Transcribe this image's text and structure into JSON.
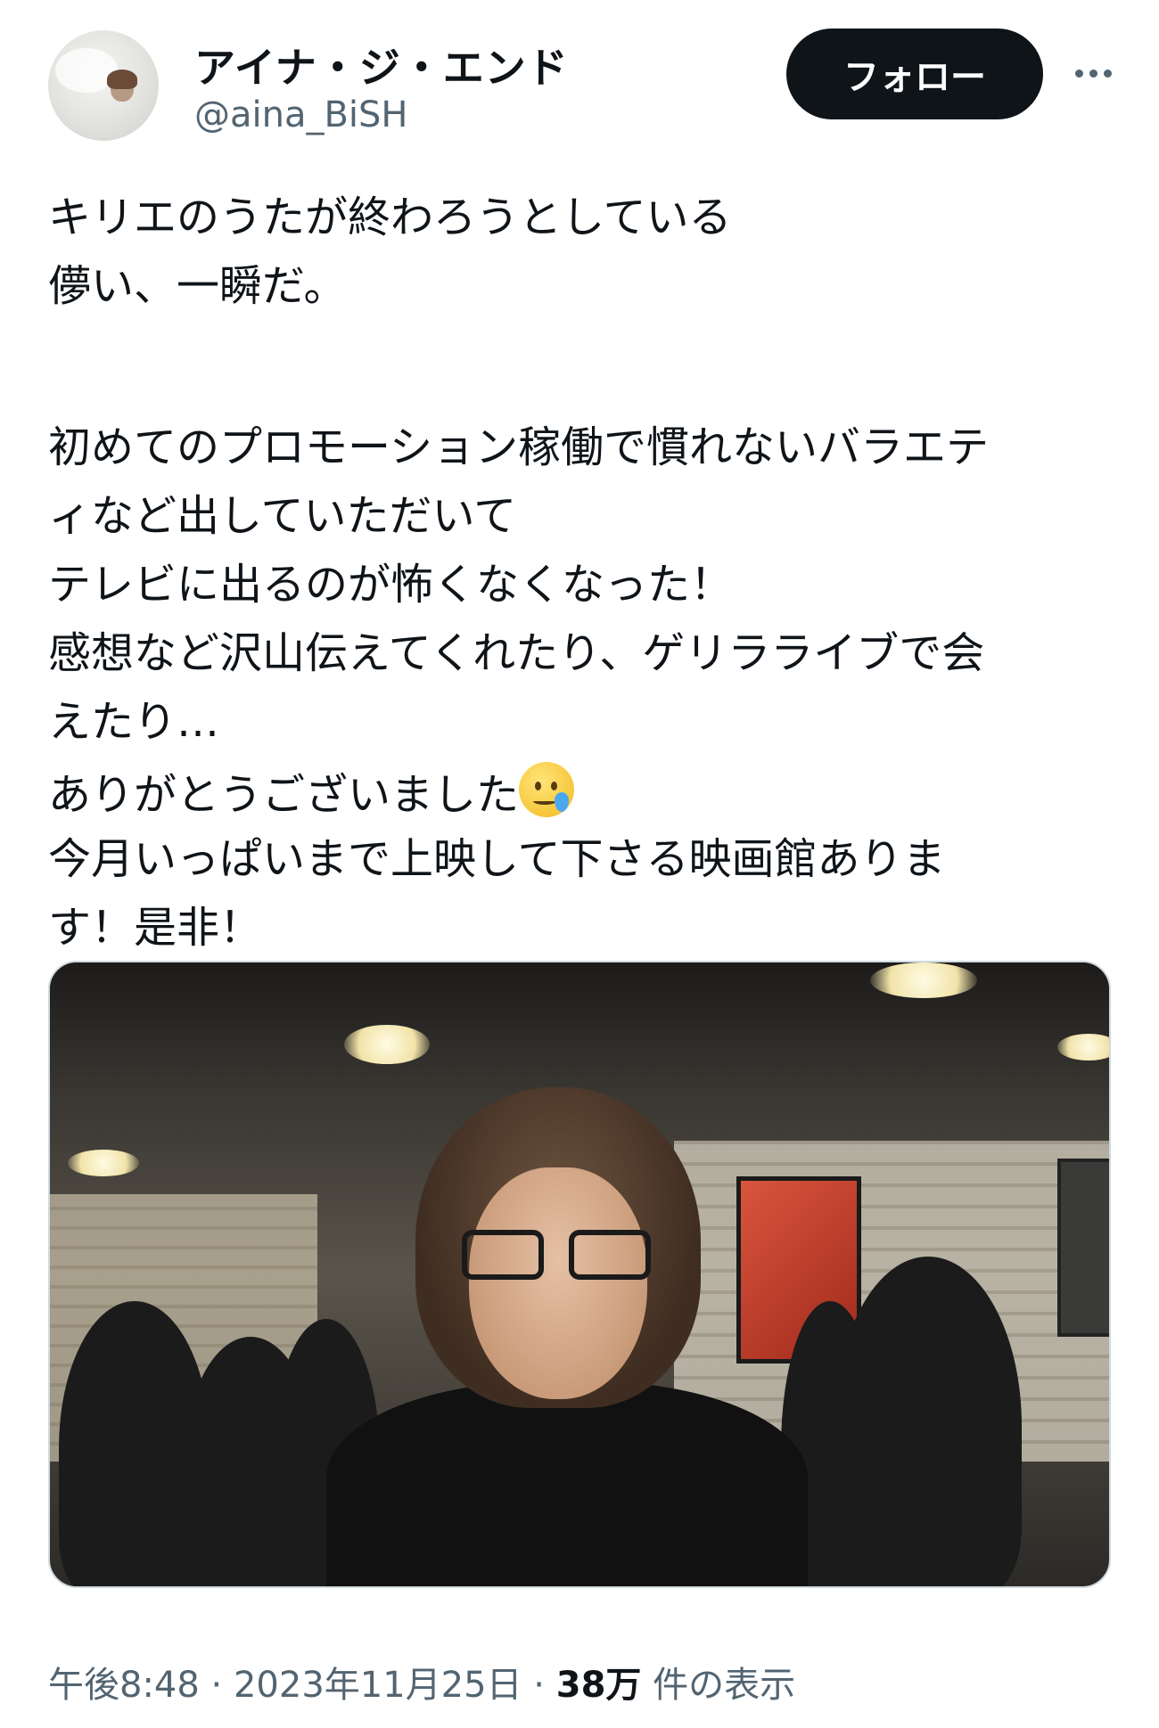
{
  "author": {
    "display_name": "アイナ・ジ・エンド",
    "handle": "@aina_BiSH",
    "avatar_icon": "profile-photo"
  },
  "actions": {
    "follow_label": "フォロー",
    "more_icon": "more-options-icon"
  },
  "tweet": {
    "lines": [
      "キリエのうたが終わろうとしている",
      "儚い、一瞬だ。",
      "",
      "初めてのプロモーション稼働で慣れないバラエテ",
      "ィなど出していただいて",
      "テレビに出るのが怖くなくなった！",
      "感想など沢山伝えてくれたり、ゲリラライブで会",
      "えたり…",
      "ありがとうございました",
      "今月いっぱいまで上映して下さる映画館ありま",
      "す！是非！"
    ],
    "emoji": "face-holding-back-tears"
  },
  "meta": {
    "time": "午後8:48",
    "sep1": " · ",
    "date": "2023年11月25日",
    "sep2": " · ",
    "views_count": "38万",
    "views_label": " 件の表示"
  }
}
